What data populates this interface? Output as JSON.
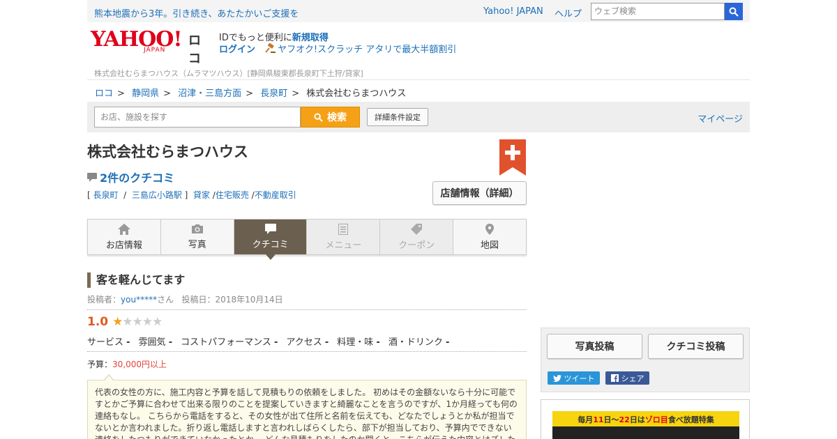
{
  "topbar": {
    "notice": "熊本地震から3年。引き続き、あたたかいご支援を",
    "yahoo_japan": "Yahoo! JAPAN",
    "help": "ヘルプ",
    "web_search_placeholder": "ウェブ検索"
  },
  "header": {
    "logo_text": "YAHOO!",
    "logo_sub": "JAPAN",
    "service": "ロコ",
    "id_text": "IDでもっと便利に",
    "signup": "新規取得",
    "login": "ログイン",
    "scratch": "ヤフオク!スクラッチ アタリで最大半額割引"
  },
  "store_address_line": "株式会社むらまつハウス（ムラマツハウス）[静岡県駿東郡長泉町下土狩/貸家]",
  "breadcrumb": [
    "ロコ",
    "静岡県",
    "沼津・三島方面",
    "長泉町",
    "株式会社むらまつハウス"
  ],
  "search": {
    "placeholder": "お店、施設を探す",
    "button": "検索",
    "detail": "詳細条件設定",
    "mypage": "マイページ"
  },
  "store": {
    "name": "株式会社むらまつハウス",
    "review_count": "2件のクチコミ",
    "area": "長泉町",
    "station": "三島広小路駅",
    "categories": [
      "貸家",
      "住宅販売",
      "不動産取引"
    ],
    "info_button": "店舗情報（詳細）"
  },
  "tabs": [
    {
      "label": "お店情報",
      "icon": "home-icon",
      "state": "normal"
    },
    {
      "label": "写真",
      "icon": "camera-icon",
      "state": "normal"
    },
    {
      "label": "クチコミ",
      "icon": "comment-icon",
      "state": "active"
    },
    {
      "label": "メニュー",
      "icon": "menu-icon",
      "state": "disabled"
    },
    {
      "label": "クーポン",
      "icon": "tag-icon",
      "state": "disabled"
    },
    {
      "label": "地図",
      "icon": "pin-icon",
      "state": "normal"
    }
  ],
  "review": {
    "title": "客を軽んじてます",
    "poster_label": "投稿者：",
    "poster": "you*****",
    "poster_suffix": "さん",
    "date": "投稿日：2018年10月14日",
    "score": "1.0",
    "rating": 1,
    "subscores": [
      {
        "label": "サービス",
        "value": "-"
      },
      {
        "label": "雰囲気",
        "value": "-"
      },
      {
        "label": "コストパフォーマンス",
        "value": "-"
      },
      {
        "label": "アクセス",
        "value": "-"
      },
      {
        "label": "料理・味",
        "value": "-"
      },
      {
        "label": "酒・ドリンク",
        "value": "-"
      }
    ],
    "budget_label": "予算：",
    "budget": "30,000円以上",
    "body": "代表の女性の方に、施工内容と予算を話して見積もりの依頼をしました。 初めはその金額ないなら十分に可能ですとかご予算に合わせて出来る限りのことを提案していきますと綺麗なことを言うのですが、1か月経っても何の連絡もなし。 こちらから電話をすると、その女性が出て住所と名前を伝えても、どなたでしょうとか私が担当でないとか言われました。折り返し電話しますと言われしばらくしたら、部下が担当しており、予算内でできない連絡をしたつもりができていなかったとか。 どんな見積もりをしたのか聞くと、こちらが伝えた内容とはズレた"
  },
  "sidebar": {
    "photo_post": "写真投稿",
    "review_post": "クチコミ投稿",
    "tweet": "ツイート",
    "share": "シェア",
    "banner_text_pre": "毎月",
    "banner_day1": "11",
    "banner_mid": "日～",
    "banner_day2": "22",
    "banner_text_post": "日は",
    "banner_highlight": "ゾロ目",
    "banner_tail": "食べ放題特集"
  }
}
